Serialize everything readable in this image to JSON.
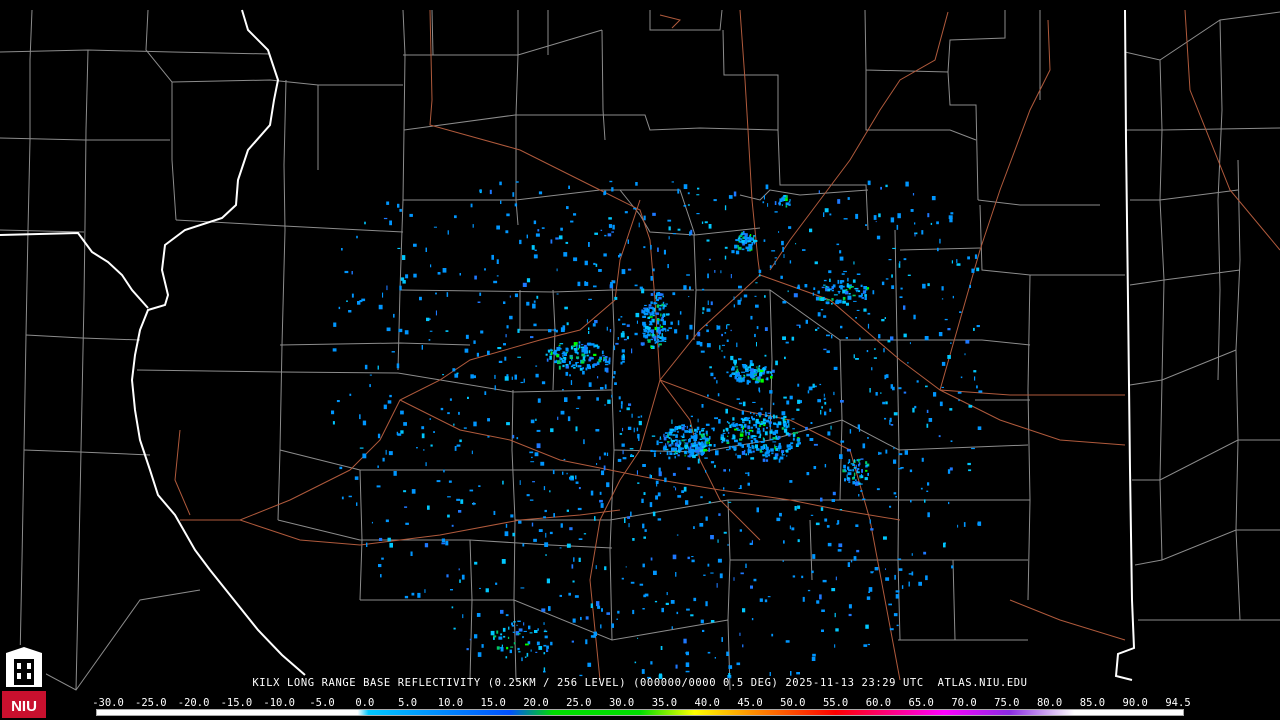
{
  "product": {
    "station": "KILX",
    "caption": "KILX LONG RANGE BASE REFLECTIVITY (0.25KM / 256 LEVEL) (000000/0000 0.5 DEG) 2025-11-13 23:29 UTC  ATLAS.NIU.EDU",
    "valid_time": "2025-11-13 23:29 UTC",
    "source": "ATLAS.NIU.EDU"
  },
  "scale": {
    "ticks": [
      "-30.0",
      "-25.0",
      "-20.0",
      "-15.0",
      "-10.0",
      "-5.0",
      "0.0",
      "5.0",
      "10.0",
      "15.0",
      "20.0",
      "25.0",
      "30.0",
      "35.0",
      "40.0",
      "45.0",
      "50.0",
      "55.0",
      "60.0",
      "65.0",
      "70.0",
      "75.0",
      "80.0",
      "85.0",
      "90.0",
      "94.5"
    ],
    "colors": {
      "below_zero": "#ffffff",
      "cyan": "#00c8ff",
      "blue": "#0050ff",
      "green": "#00dc00",
      "yellow": "#ffff00",
      "orange": "#ff9600",
      "red": "#ff0000",
      "magenta": "#ff00ff",
      "purple": "#8a2be2",
      "white": "#ffffff"
    }
  },
  "map": {
    "background": "#000000",
    "county_line_color": "#8c8c8c",
    "state_line_color": "#ffffff",
    "road_color": "#b05a3c",
    "echo_colors": [
      "#0096ff",
      "#00c8ff",
      "#1e78ff",
      "#00e6c8",
      "#00c864",
      "#00ff00"
    ]
  },
  "logo": {
    "text": "NIU"
  }
}
